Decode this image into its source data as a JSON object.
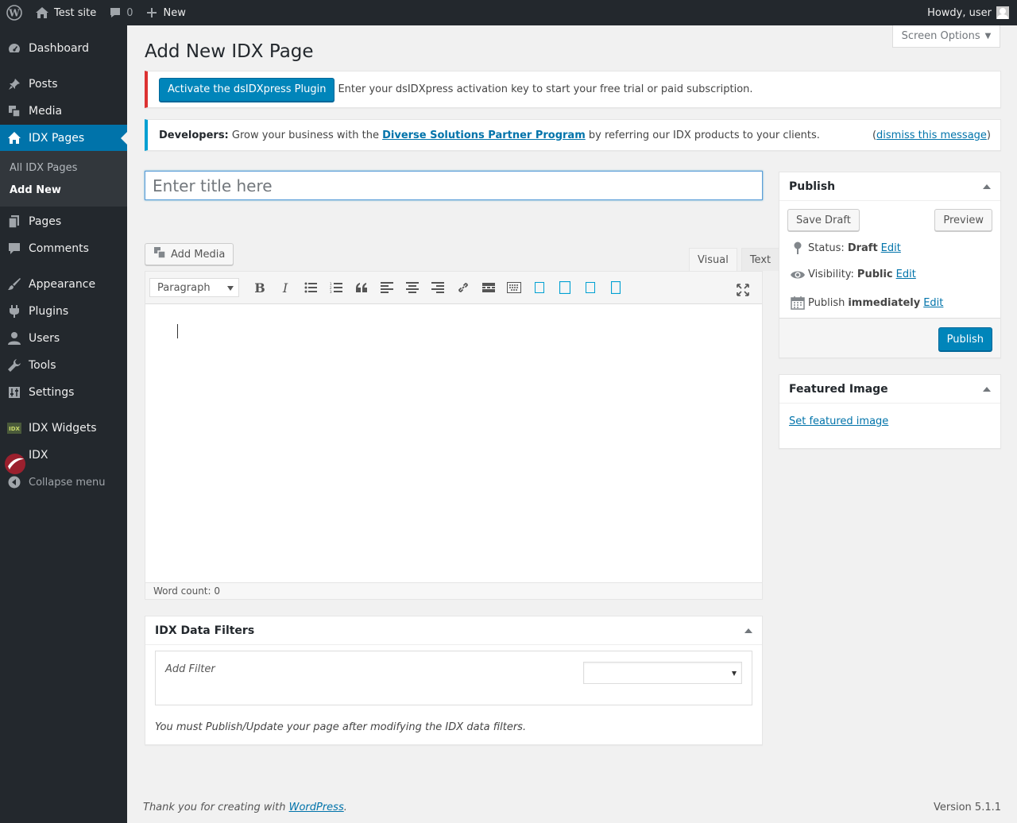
{
  "adminbar": {
    "site_name": "Test site",
    "comments_count": "0",
    "new_label": "New",
    "howdy": "Howdy, user"
  },
  "sidebar": {
    "items": [
      {
        "label": "Dashboard",
        "icon": "dashboard-icon"
      },
      {
        "label": "Posts",
        "icon": "pin-icon"
      },
      {
        "label": "Media",
        "icon": "media-icon"
      },
      {
        "label": "IDX Pages",
        "icon": "home-icon"
      },
      {
        "label": "Pages",
        "icon": "page-icon"
      },
      {
        "label": "Comments",
        "icon": "comment-icon"
      },
      {
        "label": "Appearance",
        "icon": "brush-icon"
      },
      {
        "label": "Plugins",
        "icon": "plugin-icon"
      },
      {
        "label": "Users",
        "icon": "user-icon"
      },
      {
        "label": "Tools",
        "icon": "wrench-icon"
      },
      {
        "label": "Settings",
        "icon": "settings-icon"
      },
      {
        "label": "IDX Widgets",
        "icon": "idx-widgets-icon"
      },
      {
        "label": "IDX",
        "icon": "idx-logo-icon"
      }
    ],
    "submenu": [
      "All IDX Pages",
      "Add New"
    ],
    "collapse": "Collapse menu"
  },
  "screen_options": "Screen Options",
  "page_title": "Add New IDX Page",
  "notice_error": {
    "button": "Activate the dsIDXpress Plugin",
    "text": "Enter your dsIDXpress activation key to start your free trial or paid subscription."
  },
  "notice_info": {
    "bold": "Developers:",
    "text1": "Grow your business with the",
    "link": "Diverse Solutions Partner Program",
    "text2": "by referring our IDX products to your clients.",
    "dismiss_open": "(",
    "dismiss": "dismiss this message",
    "dismiss_close": ")"
  },
  "title_placeholder": "Enter title here",
  "editor": {
    "add_media": "Add Media",
    "tab_visual": "Visual",
    "tab_text": "Text",
    "format": "Paragraph",
    "word_count": "Word count: 0"
  },
  "idx_filters": {
    "title": "IDX Data Filters",
    "add_filter": "Add Filter",
    "note": "You must Publish/Update your page after modifying the IDX data filters."
  },
  "publish": {
    "title": "Publish",
    "save_draft": "Save Draft",
    "preview": "Preview",
    "status_label": "Status:",
    "status_value": "Draft",
    "visibility_label": "Visibility:",
    "visibility_value": "Public",
    "publish_label": "Publish",
    "publish_value": "immediately",
    "edit": "Edit",
    "publish_button": "Publish"
  },
  "featured_image": {
    "title": "Featured Image",
    "link": "Set featured image"
  },
  "footer": {
    "text": "Thank you for creating with",
    "link": "WordPress",
    "period": ".",
    "version": "Version 5.1.1"
  }
}
